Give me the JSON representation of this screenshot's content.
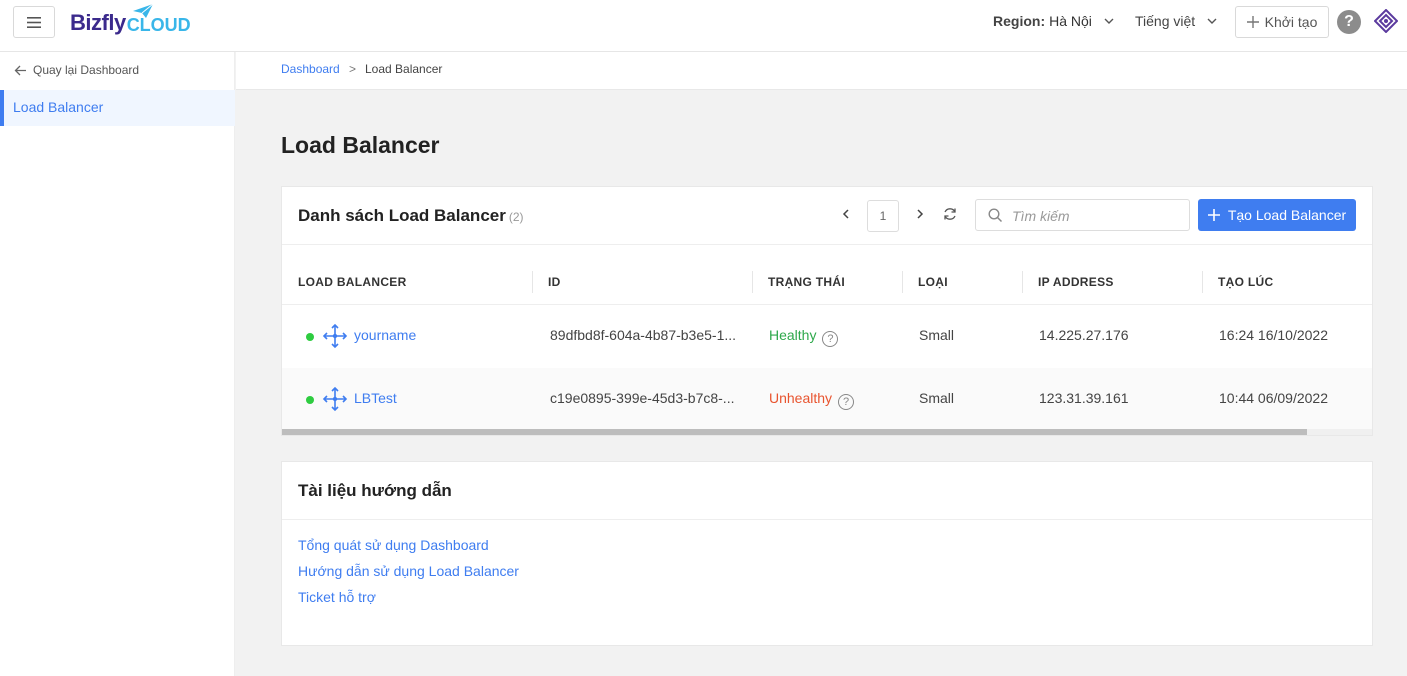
{
  "header": {
    "brand_part1": "Bizfly",
    "brand_part2": "CLOUD",
    "region_label": "Region:",
    "region_value": "Hà Nội",
    "language": "Tiếng việt",
    "create_label": "Khởi tạo",
    "help_label": "?"
  },
  "sidebar": {
    "back_label": "Quay lại Dashboard",
    "items": [
      {
        "label": "Load Balancer",
        "active": true
      }
    ]
  },
  "breadcrumb": {
    "items": [
      "Dashboard",
      "Load Balancer"
    ],
    "separator": ">"
  },
  "page": {
    "title": "Load Balancer"
  },
  "list": {
    "title": "Danh sách Load Balancer",
    "count": "(2)",
    "page": "1",
    "search_placeholder": "Tìm kiếm",
    "add_button": "Tạo Load Balancer",
    "columns": [
      "LOAD BALANCER",
      "ID",
      "TRẠNG THÁI",
      "LOẠI",
      "IP ADDRESS",
      "TẠO LÚC"
    ],
    "rows": [
      {
        "name": "yourname",
        "id": "89dfbd8f-604a-4b87-b3e5-1...",
        "status": "Healthy",
        "type": "Small",
        "ip": "14.225.27.176",
        "created": "16:24 16/10/2022"
      },
      {
        "name": "LBTest",
        "id": "c19e0895-399e-45d3-b7c8-...",
        "status": "Unhealthy",
        "type": "Small",
        "ip": "123.31.39.161",
        "created": "10:44 06/09/2022"
      }
    ]
  },
  "docs": {
    "title": "Tài liệu hướng dẫn",
    "links": [
      "Tổng quát sử dụng Dashboard",
      "Hướng dẫn sử dụng Load Balancer",
      "Ticket hỗ trợ"
    ]
  },
  "colors": {
    "accent": "#3f7df0",
    "healthy": "#2ea84b",
    "unhealthy": "#e8542f",
    "status_dot": "#2ecc40"
  }
}
